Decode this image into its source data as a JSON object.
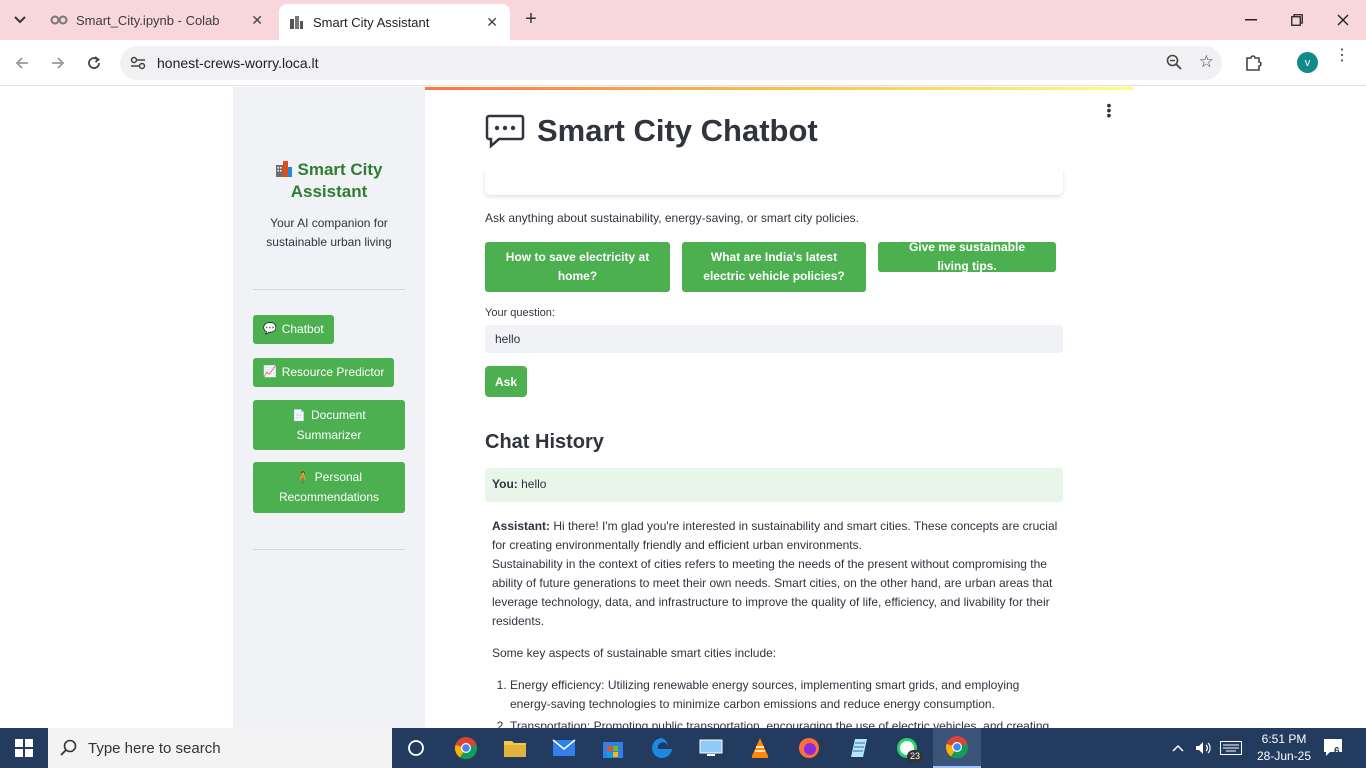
{
  "browser": {
    "tab_menu_icon": "chevron-down-icon",
    "tabs": [
      {
        "title": "Smart_City.ipynb - Colab",
        "icon": "colab-icon"
      },
      {
        "title": "Smart City Assistant",
        "icon": "streamlit-icon"
      }
    ],
    "new_tab_label": "+",
    "url": "honest-crews-worry.loca.lt",
    "profile_initial": "v"
  },
  "sidebar": {
    "title": "Smart City Assistant",
    "subtitle": "Your AI companion for sustainable urban living",
    "nav": [
      {
        "label": "Chatbot",
        "icon": "speech-balloon-icon"
      },
      {
        "label": "Resource Predictor",
        "icon": "chart-increasing-icon"
      },
      {
        "label": "Document Summarizer",
        "icon": "page-icon"
      },
      {
        "label": "Personal Recommendations",
        "icon": "person-icon"
      }
    ]
  },
  "main": {
    "title": "Smart City Chatbot",
    "intro": "Ask anything about sustainability, energy-saving, or smart city policies.",
    "suggestions": [
      "How to save electricity at home?",
      "What are India's latest electric vehicle policies?",
      "Give me sustainable living tips."
    ],
    "question_label": "Your question:",
    "question_value": "hello",
    "ask_label": "Ask",
    "history_title": "Chat History",
    "you_label": "You:",
    "you_message": "hello",
    "assistant_label": "Assistant:",
    "assistant_intro": "Hi there! I'm glad you're interested in sustainability and smart cities. These concepts are crucial for creating environmentally friendly and efficient urban environments.",
    "assistant_para2": "Sustainability in the context of cities refers to meeting the needs of the present without compromising the ability of future generations to meet their own needs. Smart cities, on the other hand, are urban areas that leverage technology, data, and infrastructure to improve the quality of life, efficiency, and livability for their residents.",
    "assistant_para3": "Some key aspects of sustainable smart cities include:",
    "assistant_list": [
      "Energy efficiency: Utilizing renewable energy sources, implementing smart grids, and employing energy-saving technologies to minimize carbon emissions and reduce energy consumption.",
      "Transportation: Promoting public transportation, encouraging the use of electric vehicles, and creating efficient, connected, and safe mobility systems."
    ]
  },
  "taskbar": {
    "search_placeholder": "Type here to search",
    "time": "6:51 PM",
    "date": "28-Jun-25",
    "whatsapp_badge": "23",
    "notification_count": "6"
  },
  "colors": {
    "accent_green": "#4caf50",
    "title_green": "#2e7d32",
    "tabbar_pink": "#f7d6dc",
    "taskbar": "#223b5e"
  }
}
